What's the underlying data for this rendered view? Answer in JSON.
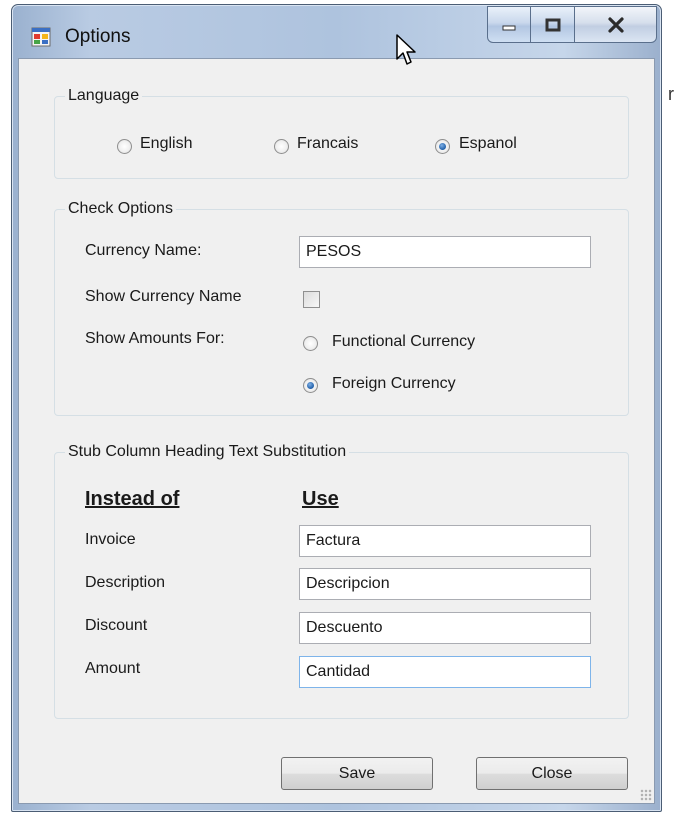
{
  "window": {
    "title": "Options"
  },
  "stray_text": "r",
  "language": {
    "legend": "Language",
    "options": [
      {
        "label": "English",
        "selected": false
      },
      {
        "label": "Francais",
        "selected": false
      },
      {
        "label": "Espanol",
        "selected": true
      }
    ]
  },
  "check_options": {
    "legend": "Check Options",
    "currency_name_label": "Currency Name:",
    "currency_name_value": "PESOS",
    "show_currency_name_label": "Show Currency Name",
    "show_currency_name_checked": false,
    "show_amounts_for_label": "Show Amounts For:",
    "amount_options": [
      {
        "label": "Functional Currency",
        "selected": false
      },
      {
        "label": "Foreign Currency",
        "selected": true
      }
    ]
  },
  "stub": {
    "legend": "Stub Column Heading Text Substitution",
    "header_instead": "Instead of",
    "header_use": "Use",
    "rows": [
      {
        "label": "Invoice",
        "value": "Factura"
      },
      {
        "label": "Description",
        "value": "Descripcion"
      },
      {
        "label": "Discount",
        "value": "Descuento"
      },
      {
        "label": "Amount",
        "value": "Cantidad"
      }
    ]
  },
  "buttons": {
    "save": "Save",
    "close": "Close"
  }
}
